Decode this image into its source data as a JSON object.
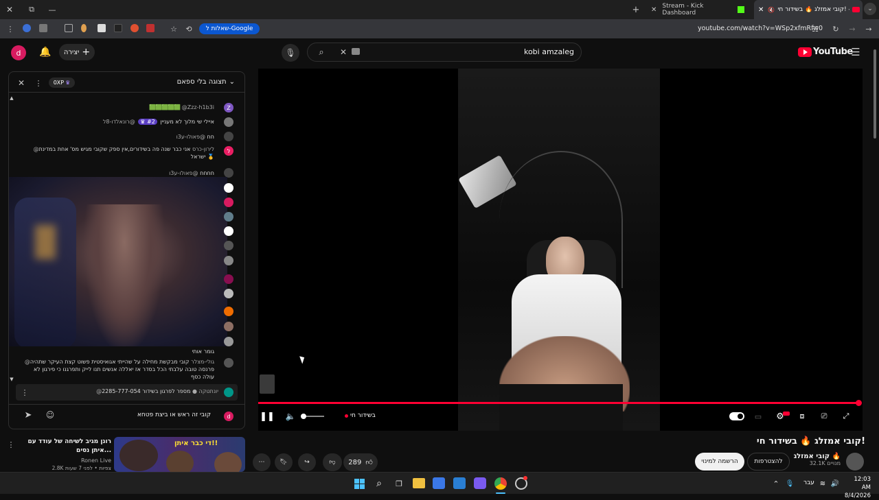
{
  "browser": {
    "tabs": [
      {
        "label": "Stream - Kick Dashboard"
      },
      {
        "label": "קובי אמזלג 🔥 בשידור חי! -"
      }
    ],
    "url": "youtube.com/watch?v=WSp2xfmRfw0",
    "google_chip": "שאלות ל-Google"
  },
  "youtube": {
    "logo_text": "YouTube",
    "create_label": "יצירה",
    "avatar_letter": "d",
    "search_value": "kobi amzaleg"
  },
  "chat": {
    "header_title": "תצוגה בלי ספאם",
    "xp_badge": "0XP",
    "messages": [
      {
        "author": "@Zzz-h1b3i",
        "text": "🟩🟩🟩🟩🟩",
        "avatar": "Z",
        "color": "#7e57c2"
      },
      {
        "author": "@רונאלדו-8ל",
        "badge": "#2",
        "text": "איילי שי מלוך לא מעניין",
        "avatar": "",
        "color": "#666"
      },
      {
        "author": "@פאולו-ע3ו",
        "text": "חח",
        "avatar": "",
        "color": "#444"
      },
      {
        "author": "@לירון-כרס",
        "text": "אני כבר שנה פה בשידורים,אין ספק שקובי מגיש מס' אחת במדינת ישראל 🥇",
        "avatar": "ל",
        "color": "#e91e63"
      },
      {
        "author": "@פאולו-ע3ו",
        "text": "חחחח",
        "avatar": "",
        "color": "#444"
      },
      {
        "author": "",
        "text": "גומר אותי",
        "avatar": "",
        "color": ""
      },
      {
        "author": "@גולי-מצלר",
        "text": "קובי מבקשת מחילה על שהייתי אגואיסטית פשוט קצת העיקר שתהיה פרנסה טובה עלבתי הכל בסדר אז יאללה אנשים תנו לייק ותפרגנו כי פירגון לא עולה כסף",
        "avatar": "",
        "color": "#555"
      }
    ],
    "pinned": {
      "author": "@יונתטקה",
      "text": "מספר לפרגון בשידור 2285-777-054"
    },
    "input_value": "קובי זה ראש או ביצת פטחא"
  },
  "player": {
    "live_label": "בשידור חי",
    "live_color": "#ff0033"
  },
  "meta": {
    "title": "קובי אמזלג 🔥 בשידור חי!",
    "channel": "קובי אמזלג 🔥",
    "subscribers": "32.1K מנויים",
    "join_label": "להצטרפות",
    "subscribe_label": "הרשמה למינוי",
    "likes": "289"
  },
  "recommended": {
    "title": "רונן מגיב לשיחה של עודד עם איתן נסים...",
    "channel": "Ronen Live",
    "stats": "2.8K צפיות • לפני 7 שעות",
    "thumb_text": "די כבר איתן!!"
  },
  "taskbar": {
    "lang": "עבר",
    "time": "12:03 AM",
    "date": "8/4/2026"
  }
}
